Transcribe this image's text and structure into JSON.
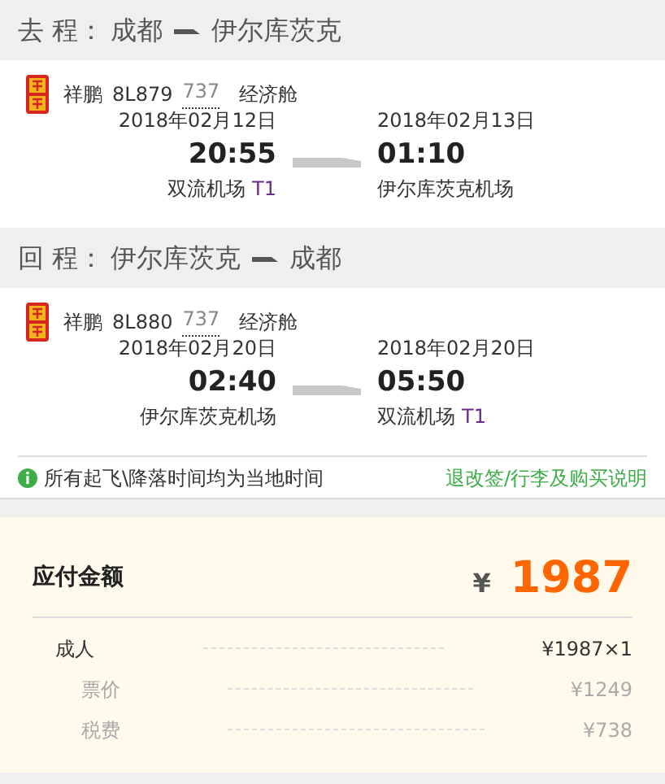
{
  "trips": [
    {
      "label": "去 程：",
      "from": "成都",
      "to": "伊尔库茨克",
      "airline": "祥鹏",
      "flight": "8L879",
      "aircraft": "737",
      "cabin": "经济舱",
      "depart": {
        "date": "2018年02月12日",
        "time": "20:55",
        "airport": "双流机场",
        "terminal": "T1"
      },
      "arrive": {
        "date": "2018年02月13日",
        "time": "01:10",
        "airport": "伊尔库茨克机场"
      }
    },
    {
      "label": "回 程：",
      "from": "伊尔库茨克",
      "to": "成都",
      "airline": "祥鹏",
      "flight": "8L880",
      "aircraft": "737",
      "cabin": "经济舱",
      "depart": {
        "date": "2018年02月20日",
        "time": "02:40",
        "airport": "伊尔库茨克机场"
      },
      "arrive": {
        "date": "2018年02月20日",
        "time": "05:50",
        "airport": "双流机场",
        "terminal": "T1"
      }
    }
  ],
  "note": "所有起飞\\降落时间均为当地时间",
  "policy_link": "退改签/行李及购买说明",
  "payment": {
    "label": "应付金额",
    "currency": "¥",
    "total": "1987",
    "lines": [
      {
        "label": "成人",
        "value": "¥1987×1",
        "kind": "main"
      },
      {
        "label": "票价",
        "value": "¥1249",
        "kind": "sub"
      },
      {
        "label": "税费",
        "value": "¥738",
        "kind": "sub"
      }
    ]
  }
}
